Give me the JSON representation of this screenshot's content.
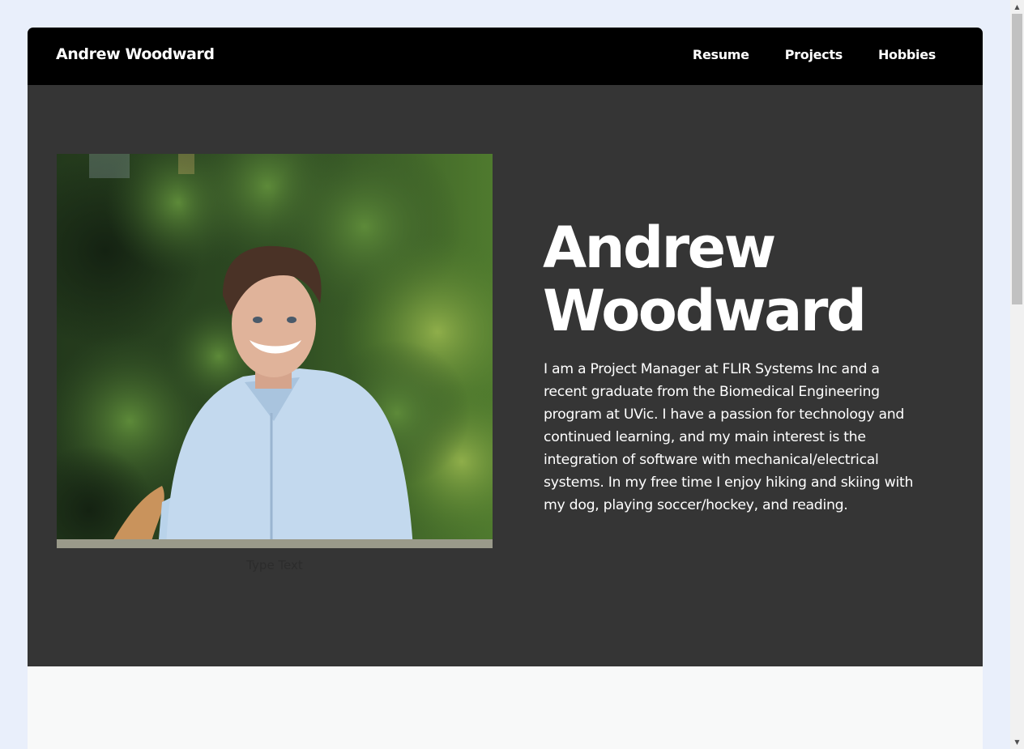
{
  "navbar": {
    "brand": "Andrew Woodward",
    "links": [
      {
        "label": "Resume"
      },
      {
        "label": "Projects"
      },
      {
        "label": "Hobbies"
      }
    ]
  },
  "hero": {
    "title_line1": "Andrew",
    "title_line2": "Woodward",
    "bio": "I am a Project Manager at FLIR Systems Inc and a recent graduate from the Biomedical Engineering program at UVic. I have a passion for technology and continued learning, and my main interest is the integration of software with mechanical/electrical systems. In my free time I enjoy hiking and skiing with my dog, playing soccer/hockey, and reading.",
    "photo_caption": "Type Text"
  },
  "colors": {
    "page_background": "#e9effb",
    "navbar": "#000000",
    "hero": "#353535",
    "text": "#ffffff",
    "lower_section": "#f8f9f9"
  },
  "scrollbar": {
    "up_icon": "triangle-up-icon",
    "down_icon": "triangle-down-icon"
  }
}
